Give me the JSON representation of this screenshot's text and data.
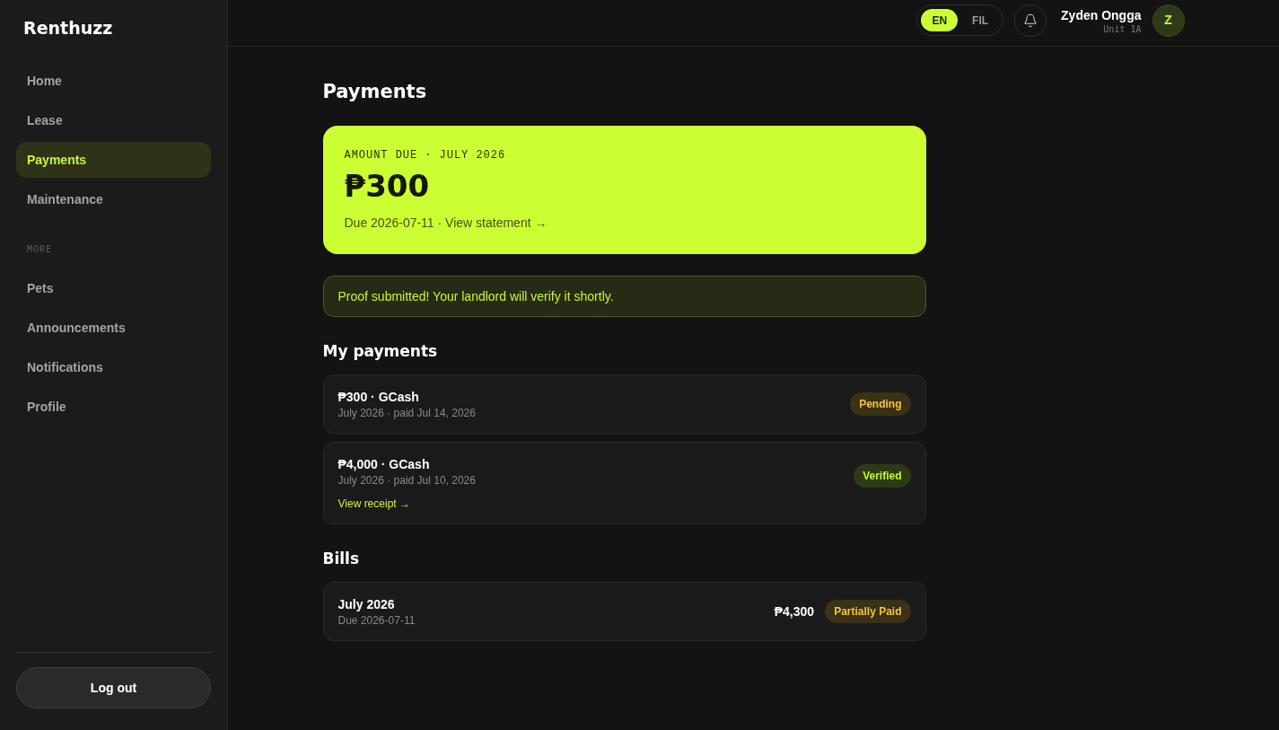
{
  "sidebar": {
    "brand": "Renthuzz",
    "sections": [
      {
        "items": [
          {
            "label": "Home",
            "selected": false
          },
          {
            "label": "Lease",
            "selected": false
          },
          {
            "label": "Payments",
            "selected": true
          },
          {
            "label": "Maintenance",
            "selected": false
          }
        ]
      },
      {
        "heading": "MORE",
        "items": [
          {
            "label": "Pets",
            "selected": false
          },
          {
            "label": "Announcements",
            "selected": false
          },
          {
            "label": "Notifications",
            "selected": false
          },
          {
            "label": "Profile",
            "selected": false
          }
        ]
      }
    ],
    "logout": "Log out"
  },
  "header": {
    "languages": [
      {
        "label": "EN",
        "selected": true
      },
      {
        "label": "FIL",
        "selected": false
      }
    ],
    "user": {
      "name": "Zyden Ongga",
      "unit": "Unit 1A",
      "initial": "Z"
    }
  },
  "page": {
    "title": "Payments",
    "amount_card": {
      "label": "AMOUNT DUE · JULY 2026",
      "amount": "₱300",
      "due_text": "Due 2026-07-11 ·",
      "link": "View statement →"
    },
    "alert": "Proof submitted! Your landlord will verify it shortly.",
    "sections": [
      {
        "title": "My payments",
        "items": [
          {
            "title": "₱300 · GCash",
            "subtitle": "July 2026 · paid Jul 14, 2026",
            "status": {
              "label": "Pending",
              "kind": "pending"
            }
          },
          {
            "title": "₱4,000 · GCash",
            "subtitle": "July 2026 · paid Jul 10, 2026",
            "link": "View receipt →",
            "status": {
              "label": "Verified",
              "kind": "verified"
            }
          }
        ]
      },
      {
        "title": "Bills",
        "items": [
          {
            "title": "July 2026",
            "subtitle": "Due 2026-07-11",
            "amount": "₱4,300",
            "status": {
              "label": "Partially Paid",
              "kind": "partial"
            }
          }
        ]
      }
    ]
  }
}
